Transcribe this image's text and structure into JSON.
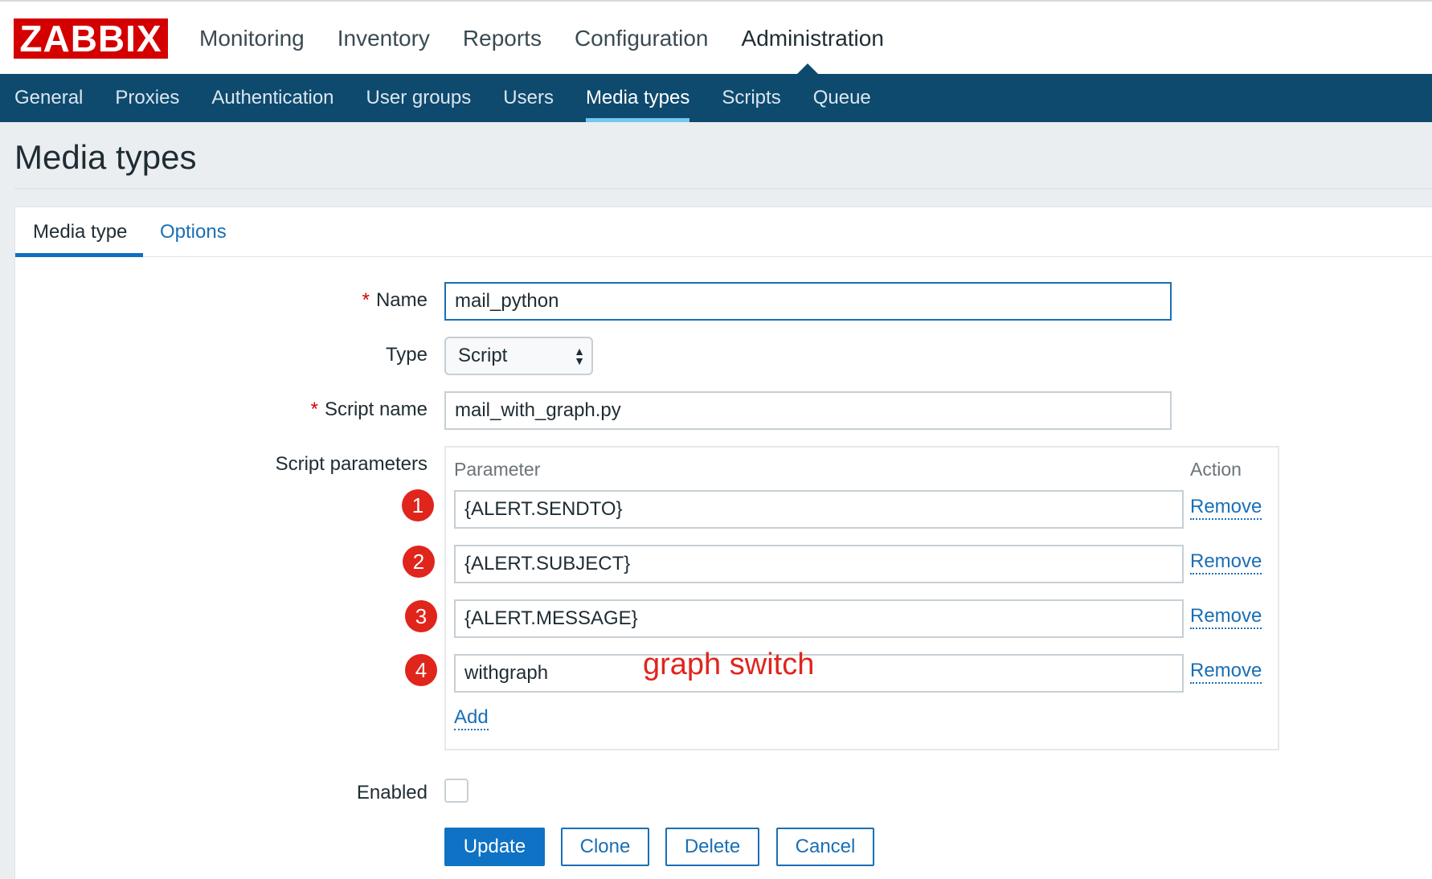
{
  "brand": {
    "logo": "ZABBIX",
    "logo_color": "#d40000",
    "nav_color": "#0e4a6e",
    "link_color": "#1a6fb5"
  },
  "main_nav": [
    {
      "label": "Monitoring"
    },
    {
      "label": "Inventory"
    },
    {
      "label": "Reports"
    },
    {
      "label": "Configuration"
    },
    {
      "label": "Administration",
      "active": true
    }
  ],
  "sub_nav": [
    {
      "label": "General"
    },
    {
      "label": "Proxies"
    },
    {
      "label": "Authentication"
    },
    {
      "label": "User groups"
    },
    {
      "label": "Users"
    },
    {
      "label": "Media types",
      "active": true
    },
    {
      "label": "Scripts"
    },
    {
      "label": "Queue"
    }
  ],
  "page_title": "Media types",
  "tabs": {
    "media_type": "Media type",
    "options": "Options"
  },
  "form": {
    "required_mark": "*",
    "name_label": "Name",
    "name_value": "mail_python",
    "type_label": "Type",
    "type_value": "Script",
    "script_name_label": "Script name",
    "script_name_value": "mail_with_graph.py",
    "script_params_label": "Script parameters",
    "param_header": "Parameter",
    "action_header": "Action",
    "params": [
      {
        "number": "1",
        "value": "{ALERT.SENDTO}",
        "remove": "Remove"
      },
      {
        "number": "2",
        "value": "{ALERT.SUBJECT}",
        "remove": "Remove"
      },
      {
        "number": "3",
        "value": "{ALERT.MESSAGE}",
        "remove": "Remove"
      },
      {
        "number": "4",
        "value": "withgraph",
        "remove": "Remove"
      }
    ],
    "add_label": "Add",
    "enabled_label": "Enabled",
    "enabled_checked": false
  },
  "annotation": {
    "text": "graph switch",
    "color": "#e0251c"
  },
  "buttons": {
    "update": "Update",
    "clone": "Clone",
    "delete": "Delete",
    "cancel": "Cancel"
  }
}
